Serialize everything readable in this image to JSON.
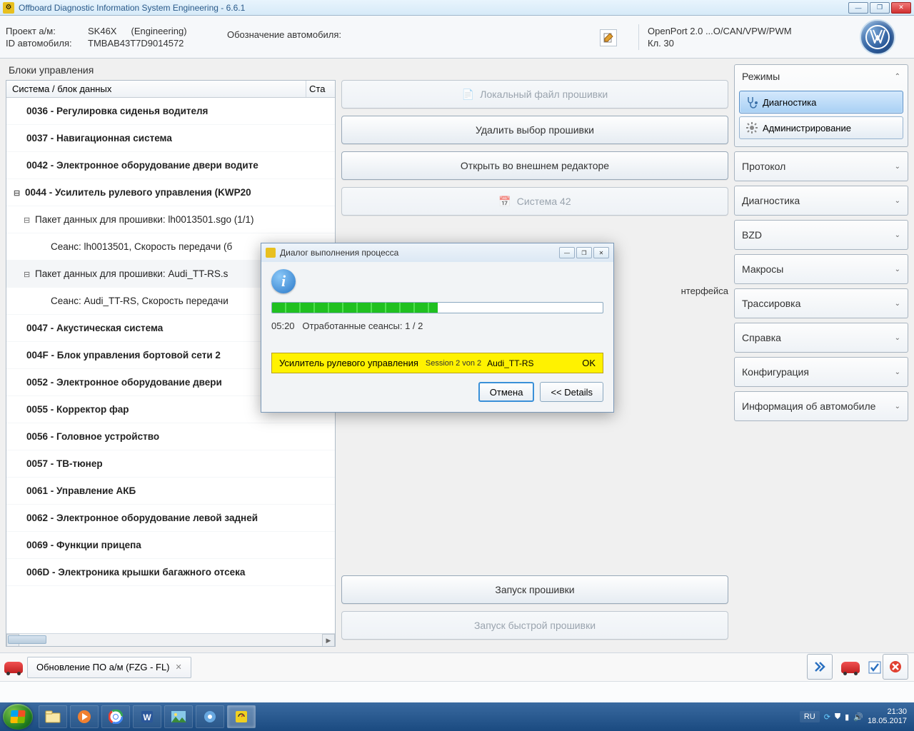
{
  "window": {
    "title": "Offboard Diagnostic Information System Engineering - 6.6.1"
  },
  "info": {
    "projectLabel": "Проект а/м:",
    "projectValue": "SK46X",
    "projectExtra": "(Engineering)",
    "vehicleIdLabel": "ID автомобиля:",
    "vehicleIdValue": "TMBAB43T7D9014572",
    "vehicleDesignationLabel": "Обозначение автомобиля:",
    "interface": "OpenPort 2.0 ...O/CAN/VPW/PWM",
    "kl": "Кл. 30"
  },
  "leftPanel": {
    "title": "Блоки управления",
    "colSystem": "Система / блок данных",
    "colStatus": "Ста"
  },
  "tree": [
    {
      "lvl": 0,
      "text": "0036 - Регулировка сиденья водителя"
    },
    {
      "lvl": 0,
      "text": "0037 - Навигационная система"
    },
    {
      "lvl": 0,
      "text": "0042 - Электронное оборудование двери водите"
    },
    {
      "lvl": 0,
      "text": "0044 - Усилитель рулевого управления  (KWP20",
      "exp": "⊟"
    },
    {
      "lvl": 1,
      "text": "Пакет данных для прошивки: lh0013501.sgo (1/1)",
      "exp": "⊟"
    },
    {
      "lvl": 2,
      "text": "Сеанс: lh0013501, Скорость передачи (б"
    },
    {
      "lvl": 1,
      "text": "Пакет данных для прошивки: Audi_TT-RS.s",
      "exp": "⊟",
      "sel": true
    },
    {
      "lvl": 2,
      "text": "Сеанс: Audi_TT-RS, Скорость передачи"
    },
    {
      "lvl": 0,
      "text": "0047 - Акустическая система"
    },
    {
      "lvl": 0,
      "text": "004F - Блок управления бортовой сети 2"
    },
    {
      "lvl": 0,
      "text": "0052 - Электронное оборудование двери"
    },
    {
      "lvl": 0,
      "text": "0055 - Корректор фар"
    },
    {
      "lvl": 0,
      "text": "0056 - Головное устройство"
    },
    {
      "lvl": 0,
      "text": "0057 - ТВ-тюнер"
    },
    {
      "lvl": 0,
      "text": "0061 - Управление АКБ"
    },
    {
      "lvl": 0,
      "text": "0062 - Электронное оборудование левой задней"
    },
    {
      "lvl": 0,
      "text": "0069 - Функции прицепа"
    },
    {
      "lvl": 0,
      "text": "006D - Электроника крышки багажного отсека"
    }
  ],
  "centerButtons": {
    "localFile": "Локальный файл прошивки",
    "deleteSel": "Удалить выбор прошивки",
    "openExt": "Открыть во внешнем редакторе",
    "system42": "Система 42",
    "interfaceFrag": "нтерфейса",
    "startFlash": "Запуск прошивки",
    "startQuick": "Запуск быстрой прошивки"
  },
  "modes": {
    "header": "Режимы",
    "diag": "Диагностика",
    "admin": "Администрирование"
  },
  "accordion": [
    "Протокол",
    "Диагностика",
    "BZD",
    "Макросы",
    "Трассировка",
    "Справка",
    "Конфигурация",
    "Информация об автомобиле"
  ],
  "tab": {
    "label": "Обновление ПО а/м (FZG - FL)"
  },
  "dialog": {
    "title": "Диалог выполнения процесса",
    "progressPct": 50,
    "time": "05:20",
    "sessionsLabel": "Отработанные сеансы: 1 / 2",
    "msgMain": "Усилитель рулевого управления",
    "msgSess": "Session 2 von 2",
    "msgName": "Audi_TT-RS",
    "msgOk": "OK",
    "cancel": "Отмена",
    "details": "<<  Details"
  },
  "taskbar": {
    "lang": "RU",
    "time": "21:30",
    "date": "18.05.2017"
  }
}
